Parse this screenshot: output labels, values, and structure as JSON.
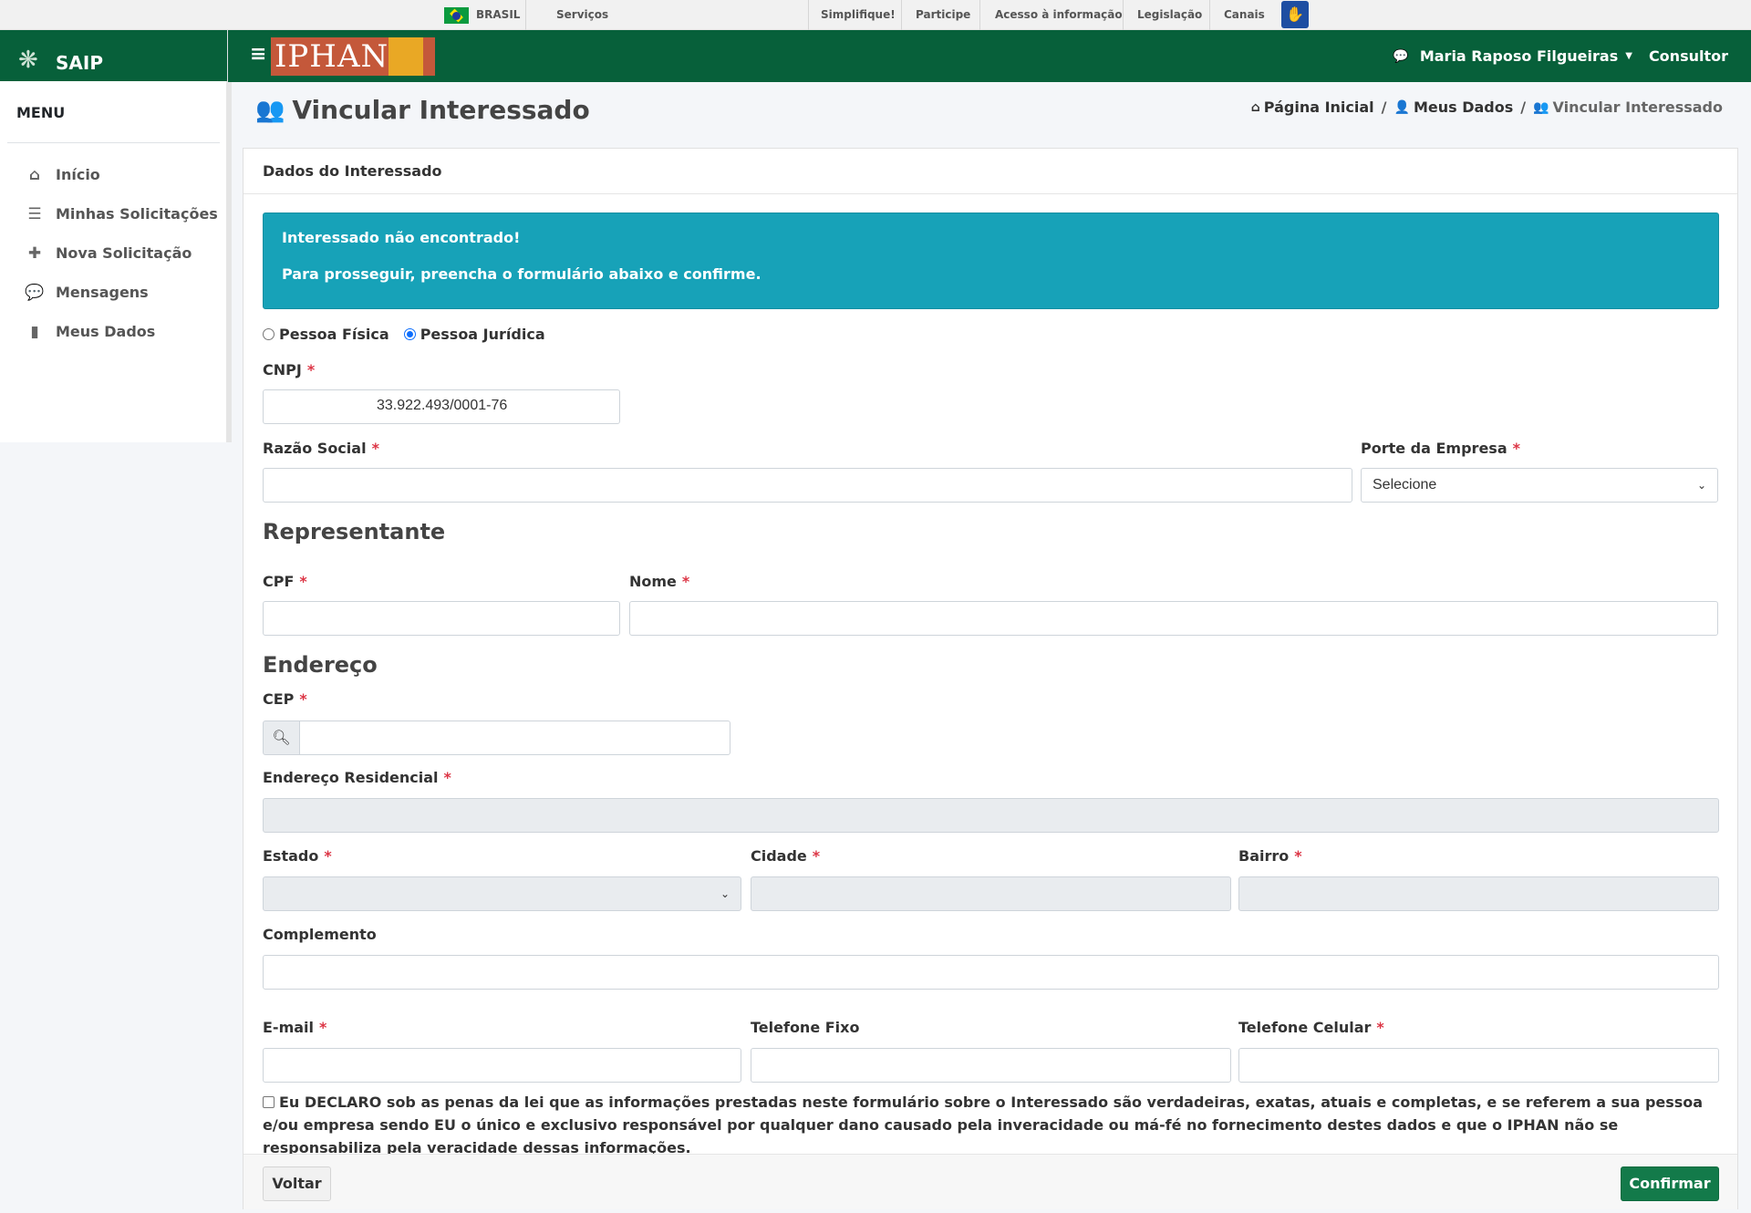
{
  "govbar": {
    "country": "BRASIL",
    "links": [
      "Serviços",
      "Simplifique!",
      "Participe",
      "Acesso à informação",
      "Legislação",
      "Canais"
    ]
  },
  "app": {
    "name": "SAIP",
    "org_logo_text": "IPHAN"
  },
  "user": {
    "name": "Maria Raposo Filgueiras",
    "role": "Consultor"
  },
  "sidebar": {
    "title": "MENU",
    "items": [
      {
        "label": "Início",
        "icon": "home-icon"
      },
      {
        "label": "Minhas Solicitações",
        "icon": "list-icon"
      },
      {
        "label": "Nova Solicitação",
        "icon": "plus-icon"
      },
      {
        "label": "Mensagens",
        "icon": "comments-icon"
      },
      {
        "label": "Meus Dados",
        "icon": "file-icon"
      }
    ]
  },
  "page": {
    "title": "Vincular Interessado",
    "breadcrumb": [
      "Página Inicial",
      "Meus Dados",
      "Vincular Interessado"
    ]
  },
  "card": {
    "header": "Dados do Interessado",
    "alert": {
      "line1": "Interessado não encontrado!",
      "line2": "Para prosseguir, preencha o formulário abaixo e confirme."
    },
    "person_type": {
      "options": [
        "Pessoa Física",
        "Pessoa Jurídica"
      ],
      "selected": "Pessoa Jurídica"
    }
  },
  "form": {
    "cnpj": {
      "label": "CNPJ",
      "value": "33.922.493/0001-76"
    },
    "razao_social": {
      "label": "Razão Social",
      "value": ""
    },
    "porte": {
      "label": "Porte da Empresa",
      "value": "Selecione"
    },
    "section_representante": "Representante",
    "cpf": {
      "label": "CPF",
      "value": ""
    },
    "nome": {
      "label": "Nome",
      "value": ""
    },
    "section_endereco": "Endereço",
    "cep": {
      "label": "CEP",
      "value": ""
    },
    "endereco": {
      "label": "Endereço Residencial",
      "value": ""
    },
    "estado": {
      "label": "Estado",
      "value": ""
    },
    "cidade": {
      "label": "Cidade",
      "value": ""
    },
    "bairro": {
      "label": "Bairro",
      "value": ""
    },
    "complemento": {
      "label": "Complemento",
      "value": ""
    },
    "email": {
      "label": "E-mail",
      "value": ""
    },
    "telefone_fixo": {
      "label": "Telefone Fixo",
      "value": ""
    },
    "telefone_celular": {
      "label": "Telefone Celular",
      "value": ""
    },
    "declaration": "Eu DECLARO sob as penas da lei que as informações prestadas neste formulário sobre o Interessado são verdadeiras, exatas, atuais e completas, e se referem a sua pessoa e/ou empresa sendo EU o único e exclusivo responsável por qualquer dano causado pela inveracidade ou má-fé no fornecimento destes dados e que o IPHAN não se responsabiliza pela veracidade dessas informações.",
    "required_mark": "*"
  },
  "footer": {
    "back_label": "Voltar",
    "confirm_label": "Confirmar"
  },
  "colors": {
    "primary_green": "#07603a",
    "info": "#17a2b8",
    "required": "#dc3545",
    "button_green": "#137a4a"
  }
}
